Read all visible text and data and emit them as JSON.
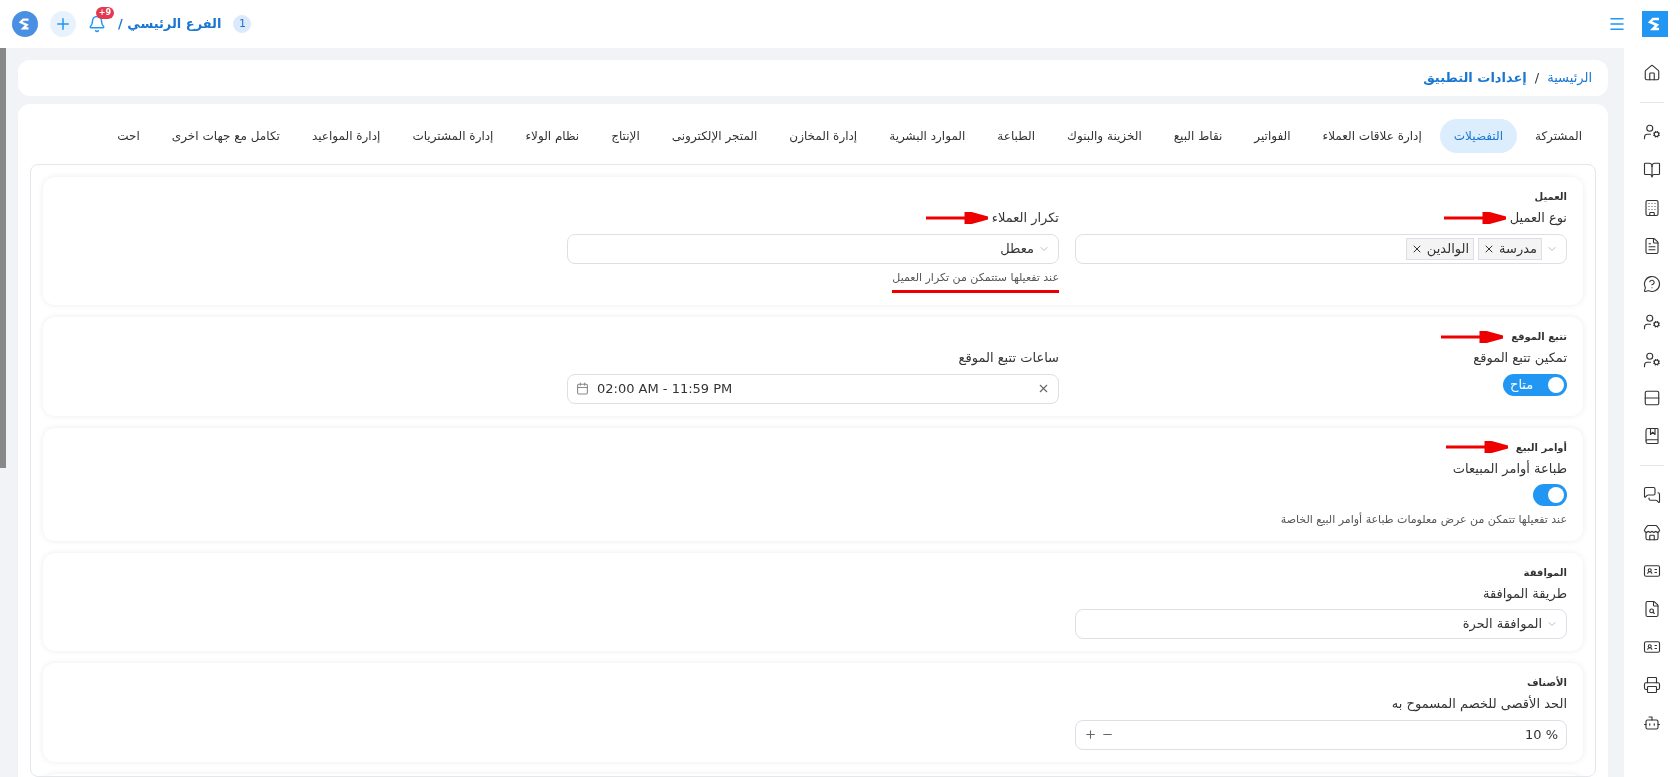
{
  "topbar": {
    "branch_count": "1",
    "branch": "الفرع الرئيسي /",
    "notification_badge": "+9"
  },
  "breadcrumb_separator": "/",
  "breadcrumb": [
    {
      "label": "الرئيسية",
      "current": false
    },
    {
      "label": "إعدادات التطبيق",
      "current": true
    }
  ],
  "tabs": [
    {
      "label": "المشتركة",
      "selected": false
    },
    {
      "label": "التفضيلات",
      "selected": true
    },
    {
      "label": "إدارة علاقات العملاء",
      "selected": false
    },
    {
      "label": "الفواتير",
      "selected": false
    },
    {
      "label": "نقاط البيع",
      "selected": false
    },
    {
      "label": "الخزينة والبنوك",
      "selected": false
    },
    {
      "label": "الطباعة",
      "selected": false
    },
    {
      "label": "الموارد البشرية",
      "selected": false
    },
    {
      "label": "إدارة المخازن",
      "selected": false
    },
    {
      "label": "المتجر الإلكترونى",
      "selected": false
    },
    {
      "label": "الإنتاج",
      "selected": false
    },
    {
      "label": "نظام الولاء",
      "selected": false
    },
    {
      "label": "إدارة المشتريات",
      "selected": false
    },
    {
      "label": "إدارة المواعيد",
      "selected": false
    },
    {
      "label": "تكامل مع جهات اخرى",
      "selected": false
    },
    {
      "label": "احت",
      "selected": false
    }
  ],
  "sections": [
    {
      "title": "العميل",
      "arrow": false,
      "fields": [
        {
          "kind": "multiselect",
          "label": "نوع العميل",
          "arrow": true,
          "tags": [
            "مدرسة",
            "الوالدين"
          ]
        },
        {
          "kind": "select",
          "label": "تكرار العملاء",
          "arrow": true,
          "value": "معطل",
          "hint": "عند تفعيلها ستتمكن من تكرار العميل",
          "hint_underlined": true
        }
      ]
    },
    {
      "title": "تتبع الموقع",
      "arrow": true,
      "fields": [
        {
          "kind": "toggle",
          "label": "تمكين تتبع الموقع",
          "arrow": false,
          "on": true,
          "text": "متاح"
        },
        {
          "kind": "daterange",
          "label": "ساعات تتبع الموقع",
          "arrow": false,
          "value": "02:00 AM - 11:59 PM"
        }
      ]
    },
    {
      "title": "أوامر البيع",
      "arrow": true,
      "fields": [
        {
          "kind": "toggle",
          "label": "طباعة أوامر المبيعات",
          "arrow": false,
          "on": true,
          "hint": "عند تفعيلها تتمكن من عرض معلومات طباعة أوامر البيع الخاصة",
          "hint_underlined": false
        }
      ]
    },
    {
      "title": "الموافقة",
      "arrow": false,
      "fields": [
        {
          "kind": "select",
          "label": "طريقة الموافقة",
          "arrow": false,
          "value": "الموافقة الحرة"
        }
      ]
    },
    {
      "title": "الأصناف",
      "arrow": false,
      "fields": [
        {
          "kind": "number",
          "label": "الحد الأقصى للخصم المسموح به",
          "arrow": false,
          "value": "10",
          "unit": "%"
        }
      ]
    }
  ]
}
